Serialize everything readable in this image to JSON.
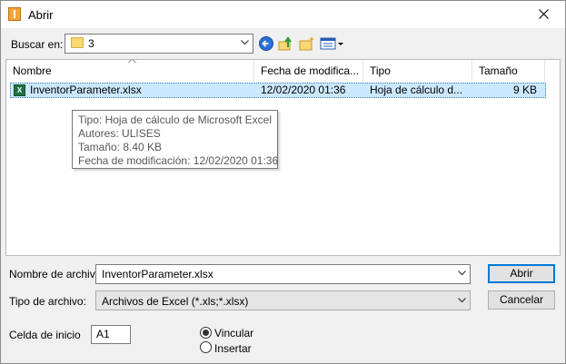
{
  "window": {
    "title": "Abrir"
  },
  "toolbar": {
    "look_in_label": "Buscar en:",
    "look_in_value": "3",
    "icons": [
      "back-icon",
      "up-folder-icon",
      "new-folder-icon",
      "view-menu-icon"
    ]
  },
  "file_list": {
    "columns": [
      "Nombre",
      "Fecha de modifica...",
      "Tipo",
      "Tamaño"
    ],
    "rows": [
      {
        "name": "InventorParameter.xlsx",
        "date": "12/02/2020 01:36",
        "type": "Hoja de cálculo d...",
        "size": "9 KB"
      }
    ]
  },
  "tooltip": {
    "lines": [
      "Tipo: Hoja de cálculo de Microsoft Excel",
      "Autores: ULISES",
      "Tamaño: 8.40 KB",
      "Fecha de modificación: 12/02/2020 01:36"
    ]
  },
  "form": {
    "filename_label": "Nombre de archivo:",
    "filename_value": "InventorParameter.xlsx",
    "filetype_label": "Tipo de archivo:",
    "filetype_value": "Archivos de Excel (*.xls;*.xlsx)",
    "open_button": "Abrir",
    "cancel_button": "Cancelar",
    "start_cell_label": "Celda de inicio",
    "start_cell_value": "A1",
    "radio_link": "Vincular",
    "radio_insert": "Insertar",
    "selected_option": "Vincular"
  },
  "colors": {
    "selection": "#cce8ff",
    "accent": "#0078d7",
    "excel": "#1e7145"
  }
}
